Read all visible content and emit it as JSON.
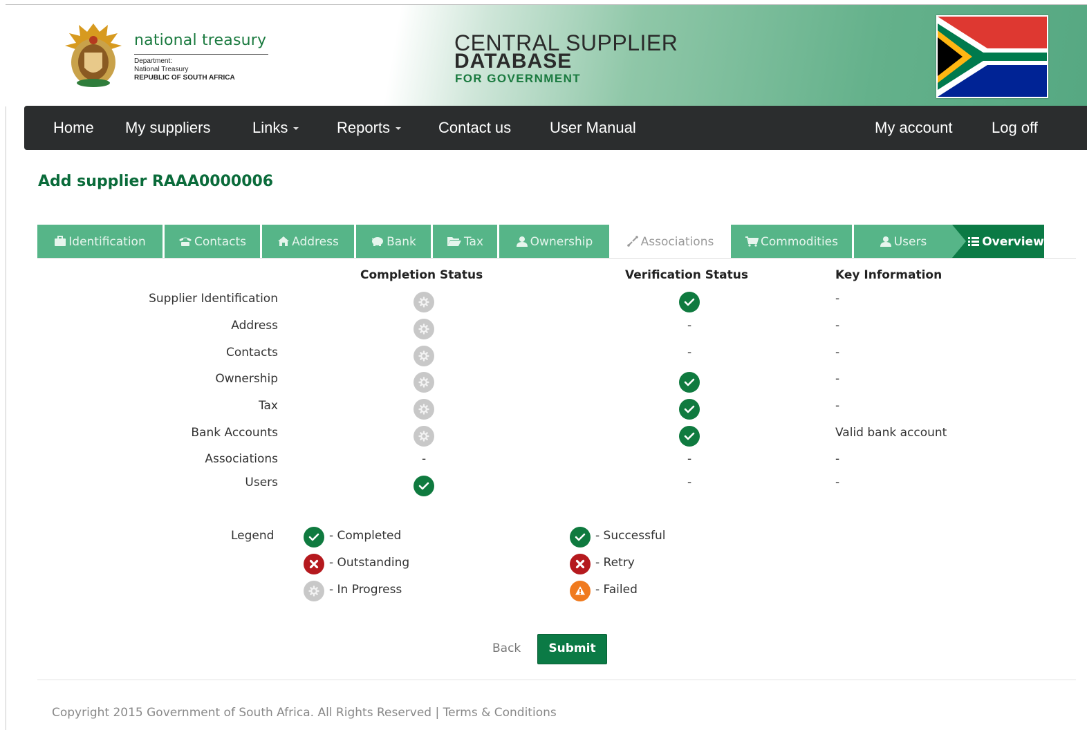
{
  "header": {
    "org_name": "national treasury",
    "org_sub1": "Department:",
    "org_sub2": "National Treasury",
    "org_sub3": "REPUBLIC OF SOUTH AFRICA",
    "title_line1": "CENTRAL SUPPLIER",
    "title_line2": "DATABASE",
    "title_line3": "FOR GOVERNMENT",
    "crest_icon": "coat-of-arms-icon",
    "flag_icon": "south-africa-flag-icon"
  },
  "nav": {
    "home": "Home",
    "my_suppliers": "My suppliers",
    "links": "Links",
    "reports": "Reports",
    "contact_us": "Contact us",
    "user_manual": "User Manual",
    "my_account": "My account",
    "log_off": "Log off"
  },
  "page": {
    "title": "Add supplier RAAA0000006"
  },
  "tabs": [
    {
      "label": "Identification",
      "icon": "briefcase-icon",
      "state": "done"
    },
    {
      "label": "Contacts",
      "icon": "phone-icon",
      "state": "done"
    },
    {
      "label": "Address",
      "icon": "home-icon",
      "state": "done"
    },
    {
      "label": "Bank",
      "icon": "piggy-bank-icon",
      "state": "done"
    },
    {
      "label": "Tax",
      "icon": "folder-open-icon",
      "state": "done"
    },
    {
      "label": "Ownership",
      "icon": "user-icon",
      "state": "done"
    },
    {
      "label": "Associations",
      "icon": "link-icon",
      "state": "inactive"
    },
    {
      "label": "Commodities",
      "icon": "cart-icon",
      "state": "done"
    },
    {
      "label": "Users",
      "icon": "user-icon",
      "state": "done"
    },
    {
      "label": "Overview",
      "icon": "list-icon",
      "state": "active"
    }
  ],
  "table": {
    "headers": {
      "completion": "Completion Status",
      "verification": "Verification Status",
      "key_info": "Key Information"
    },
    "rows": [
      {
        "label": "Supplier Identification",
        "completion": "in-progress",
        "verification": "successful",
        "key_info": "-"
      },
      {
        "label": "Address",
        "completion": "in-progress",
        "verification": "-",
        "key_info": "-"
      },
      {
        "label": "Contacts",
        "completion": "in-progress",
        "verification": "-",
        "key_info": "-"
      },
      {
        "label": "Ownership",
        "completion": "in-progress",
        "verification": "successful",
        "key_info": "-"
      },
      {
        "label": "Tax",
        "completion": "in-progress",
        "verification": "successful",
        "key_info": "-"
      },
      {
        "label": "Bank Accounts",
        "completion": "in-progress",
        "verification": "successful",
        "key_info": "Valid bank account"
      },
      {
        "label": "Associations",
        "completion": "-",
        "verification": "-",
        "key_info": "-"
      },
      {
        "label": "Users",
        "completion": "completed",
        "verification": "-",
        "key_info": "-"
      }
    ]
  },
  "legend": {
    "title": "Legend",
    "completed": "- Completed",
    "outstanding": "- Outstanding",
    "in_progress": "- In Progress",
    "successful": "- Successful",
    "retry": "- Retry",
    "failed": "- Failed"
  },
  "actions": {
    "back": "Back",
    "submit": "Submit"
  },
  "footer": {
    "text": "Copyright 2015 Government of South Africa. All Rights Reserved | Terms & Conditions"
  },
  "colors": {
    "nav_bg": "#2b2d2e",
    "tab_green": "#56b588",
    "tab_active": "#0b7a45",
    "status_ok": "#0f7a3f",
    "status_progress": "#c8c8c8",
    "status_error": "#b5191e",
    "status_warn": "#f07a1e",
    "title_green": "#0a6b3a"
  }
}
